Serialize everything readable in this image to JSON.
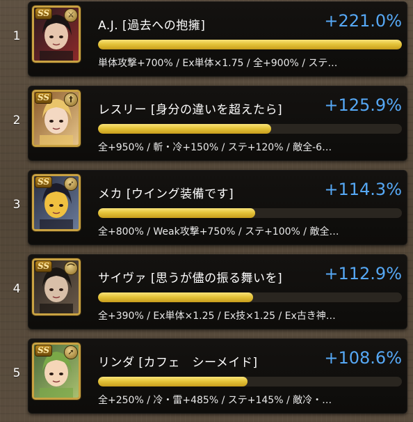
{
  "rankings": [
    {
      "rank": "1",
      "name": "A.J. [過去への抱擁]",
      "percent": "+221.0%",
      "bar_fraction": 1.0,
      "details": "単体攻撃+700% / Ex単体×1.75 / 全+900% / ステ…",
      "rarity_badge": "SS",
      "type_icon": "sword-icon",
      "colors": {
        "portrait_a": "#2b1b20",
        "portrait_b": "#8c2a2a",
        "hair": "#1a1414",
        "skin": "#e7c6ae",
        "frame": "#c9a242"
      }
    },
    {
      "rank": "2",
      "name": "レスリー [身分の違いを超えたら]",
      "percent": "+125.9%",
      "bar_fraction": 0.57,
      "details": "全+950% / 斬・冷+150% / ステ+120% / 敵全-6…",
      "rarity_badge": "SS",
      "type_icon": "dagger-icon",
      "colors": {
        "portrait_a": "#8a5a2a",
        "portrait_b": "#e6c48a",
        "hair": "#e9c46a",
        "skin": "#f3d8c2",
        "frame": "#c9a242"
      }
    },
    {
      "rank": "3",
      "name": "メカ [ウイング装備です]",
      "percent": "+114.3%",
      "bar_fraction": 0.517,
      "details": "全+800% / Weak攻撃+750% / ステ+100% / 敵全…",
      "rarity_badge": "SS",
      "type_icon": "gun-icon",
      "colors": {
        "portrait_a": "#2a3042",
        "portrait_b": "#6a7a9a",
        "hair": "#1c1c2a",
        "skin": "#f0c040",
        "frame": "#c9a242"
      }
    },
    {
      "rank": "4",
      "name": "サイヴァ [思うが儘の振る舞いを]",
      "percent": "+112.9%",
      "bar_fraction": 0.51,
      "details": "全+390% / Ex単体×1.25 / Ex技×1.25 / Ex古き神…",
      "rarity_badge": "SS",
      "type_icon": "bow-icon",
      "colors": {
        "portrait_a": "#2a2420",
        "portrait_b": "#6a5a4a",
        "hair": "#1a1612",
        "skin": "#d8bfa8",
        "frame": "#c9a242"
      }
    },
    {
      "rank": "5",
      "name": "リンダ [カフェ　シーメイド]",
      "percent": "+108.6%",
      "bar_fraction": 0.491,
      "details": "全+250% / 冷・雷+485% / ステ+145% / 敵冷・…",
      "rarity_badge": "SS",
      "type_icon": "spear-icon",
      "colors": {
        "portrait_a": "#4a6a3a",
        "portrait_b": "#a8c070",
        "hair": "#7aa848",
        "skin": "#f5d6b8",
        "frame": "#c9a242"
      }
    }
  ]
}
